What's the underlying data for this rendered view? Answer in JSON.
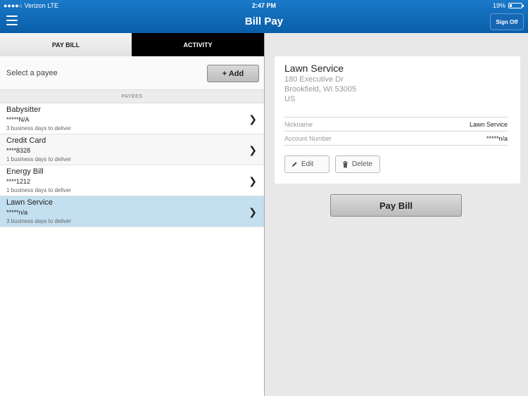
{
  "status": {
    "carrier": "●●●●○ Verizon  LTE",
    "time": "2:47 PM",
    "battery": "19%",
    "battery_level": 0.19
  },
  "nav": {
    "menu_icon": "hamburger-icon",
    "title": "Bill Pay",
    "sign_off": "Sign Off"
  },
  "tabs": [
    {
      "label": "PAY BILL",
      "active": true
    },
    {
      "label": "ACTIVITY",
      "active": false
    }
  ],
  "select_payee": {
    "label": "Select a payee",
    "add_label": "+ Add"
  },
  "payees_header": "PAYEES",
  "payees": [
    {
      "name": "Babysitter",
      "account": "*****N/A",
      "delivery": "3 business days to deliver"
    },
    {
      "name": "Credit Card",
      "account": "****8328",
      "delivery": "1 business days to deliver"
    },
    {
      "name": "Energy Bill",
      "account": "****1212",
      "delivery": "1 business days to deliver"
    },
    {
      "name": "Lawn Service",
      "account": "*****n/a",
      "delivery": "3 business days to deliver"
    }
  ],
  "selected_payee_index": 3,
  "detail": {
    "name": "Lawn Service",
    "address_line1": "180 Executive Dr",
    "address_line2": "Brookfield, WI 53005",
    "address_line3": "US",
    "nickname_label": "Nickname",
    "nickname_value": "Lawn Service",
    "account_label": "Account Number",
    "account_value": "*****n/a",
    "edit_label": "Edit",
    "delete_label": "Delete"
  },
  "pay_bill_label": "Pay Bill",
  "colors": {
    "nav_blue": "#0a5ea8",
    "selected_row": "#c3dff0",
    "tab_inactive": "#000000"
  }
}
